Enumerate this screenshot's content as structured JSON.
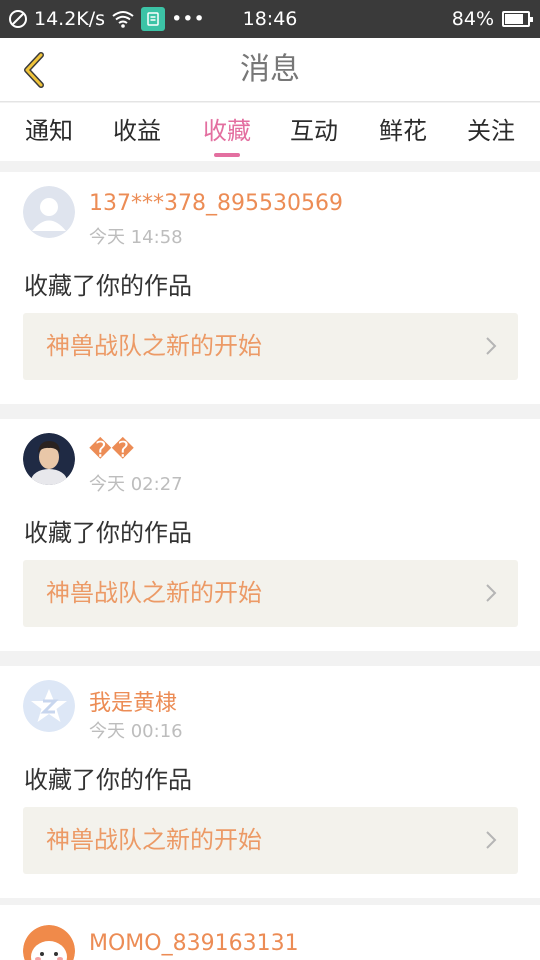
{
  "status_bar": {
    "speed": "14.2K/s",
    "dots": "•••",
    "time": "18:46",
    "battery_text": "84%",
    "battery_level": 0.84,
    "icons": [
      "blocked-icon",
      "wifi-icon",
      "app-notification-icon",
      "battery-icon"
    ]
  },
  "header": {
    "title": "消息",
    "back_icon": "chevron-left-icon"
  },
  "tabs": [
    {
      "label": "通知"
    },
    {
      "label": "收益"
    },
    {
      "label": "收藏",
      "active": true
    },
    {
      "label": "互动"
    },
    {
      "label": "鲜花"
    },
    {
      "label": "关注"
    }
  ],
  "colors": {
    "accent_pink": "#e36fa0",
    "username_orange": "#ec8c55",
    "link_bg": "#f3f2ec"
  },
  "notifications": [
    {
      "username": "137***378_895530569",
      "time": "今天 14:58",
      "message": "收藏了你的作品",
      "work_title": "神兽战队之新的开始",
      "avatar": "default-avatar-icon"
    },
    {
      "username": "��",
      "time": "今天 02:27",
      "message": "收藏了你的作品",
      "work_title": "神兽战队之新的开始",
      "avatar": "photo-avatar"
    },
    {
      "username": "我是黄棣",
      "time": "今天 00:16",
      "message": "收藏了你的作品",
      "work_title": "神兽战队之新的开始",
      "avatar": "qzone-star-avatar"
    },
    {
      "username": "MOMO_839163131",
      "avatar": "cartoon-avatar"
    }
  ]
}
